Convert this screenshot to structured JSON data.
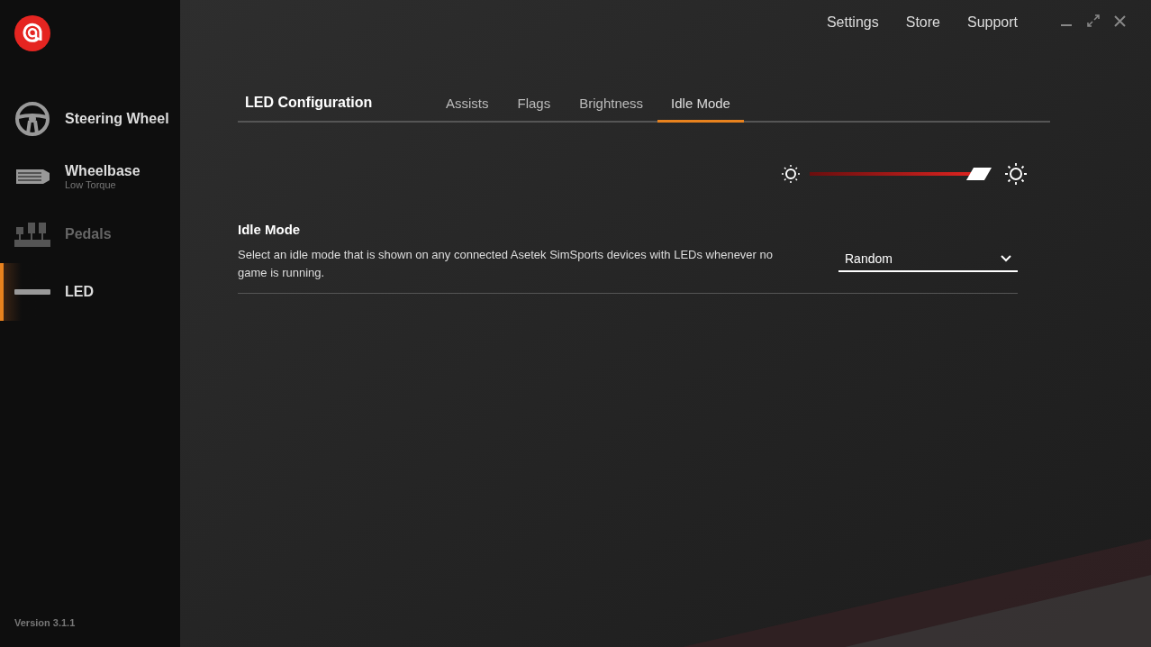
{
  "top_menu": [
    "Settings",
    "Store",
    "Support"
  ],
  "sidebar": {
    "items": [
      {
        "kind": "wheel",
        "label": "Steering Wheel",
        "selected": false,
        "disabled": false
      },
      {
        "kind": "base",
        "label": "Wheelbase",
        "sublabel": "Low Torque",
        "selected": false,
        "disabled": false
      },
      {
        "kind": "pedals",
        "label": "Pedals",
        "selected": false,
        "disabled": true
      },
      {
        "kind": "led",
        "label": "LED",
        "selected": true,
        "disabled": false
      }
    ],
    "version": "Version 3.1.1"
  },
  "header": {
    "title": "LED Configuration",
    "tabs": [
      {
        "label": "Assists",
        "selected": false
      },
      {
        "label": "Flags",
        "selected": false
      },
      {
        "label": "Brightness",
        "selected": false
      },
      {
        "label": "Idle Mode",
        "selected": true
      }
    ]
  },
  "brightness": {
    "level": 0.93
  },
  "setting": {
    "title": "Idle Mode",
    "description": "Select an idle mode that is shown on any connected Asetek SimSports devices with LEDs whenever no game is running.",
    "value": "Random"
  }
}
